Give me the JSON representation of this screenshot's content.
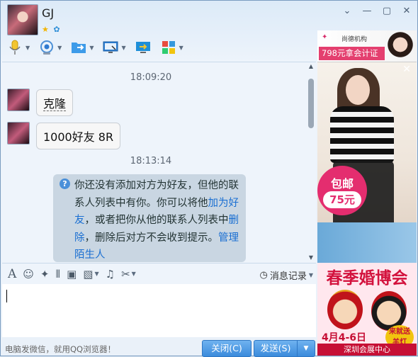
{
  "header": {
    "contact_name": "GJ",
    "icons": [
      "star-icon",
      "qzone-icon"
    ],
    "window_controls": [
      "collapse",
      "minimize",
      "maximize",
      "close"
    ]
  },
  "toolbar": {
    "items": [
      {
        "name": "voice-call-icon"
      },
      {
        "name": "video-call-icon"
      },
      {
        "name": "send-file-icon"
      },
      {
        "name": "remote-desktop-icon"
      },
      {
        "name": "share-screen-icon"
      },
      {
        "name": "apps-icon"
      }
    ]
  },
  "chat": {
    "messages": [
      {
        "type": "time",
        "text": "18:09:20"
      },
      {
        "type": "incoming",
        "text": "克隆"
      },
      {
        "type": "incoming",
        "text": "1000好友 8R"
      },
      {
        "type": "time",
        "text": "18:13:14"
      }
    ],
    "system_notice": {
      "part1": "你还没有添加对方为好友，但他的联系人列表中有你。你可以将他",
      "link1": "加为好友",
      "part2": "，或者把你从他的联系人列表中",
      "link2": "删除",
      "part3": "，删除后对方不会收到提示。",
      "link3": "管理陌生人"
    }
  },
  "input_toolbar": {
    "history_label": "消息记录"
  },
  "footer": {
    "promo_text": "电脑发微信，就用QQ浏览器！",
    "close_label": "关闭(C)",
    "send_label": "发送(S)"
  },
  "ads": {
    "top_brand": "尚德机构",
    "top_price": "798元拿会计证",
    "badge_line1": "包邮",
    "badge_line2": "75元",
    "bottom_title": "春季婚博会",
    "bottom_date": "4月4-6日",
    "bottom_venue": "深圳会展中心",
    "bottom_gift": "来就送 羊灯"
  }
}
